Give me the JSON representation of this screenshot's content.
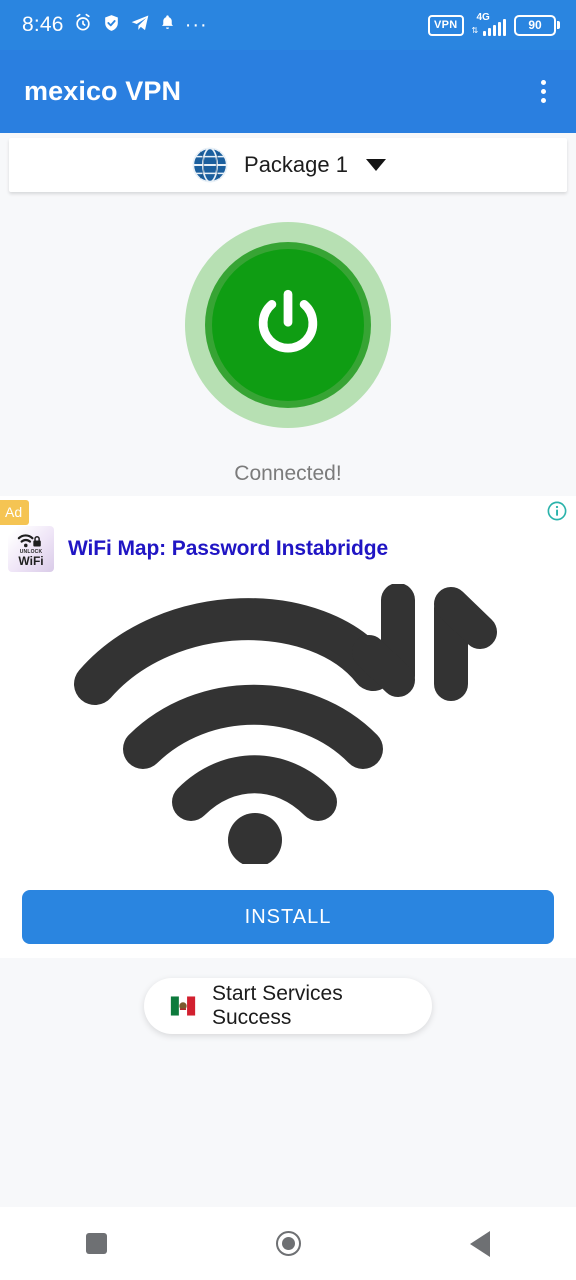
{
  "status_bar": {
    "time": "8:46",
    "left_icons": [
      "alarm-clock-icon",
      "shield-check-icon",
      "telegram-icon",
      "bell-icon",
      "more-dots-icon"
    ],
    "ellipsis": "···",
    "vpn_label": "VPN",
    "network_type": "4G",
    "battery_level": "90",
    "bg_color": "#2a85e0"
  },
  "app_bar": {
    "title": "mexico VPN",
    "overflow_name": "overflow-menu",
    "bg_color": "#2a7fe0"
  },
  "package_selector": {
    "icon": "globe-icon",
    "label": "Package 1",
    "caret": "chevron-down-icon"
  },
  "connection": {
    "button_name": "power-toggle-button",
    "state_label": "Connected!",
    "on_color": "#0f9d13",
    "halo_color": "#b7e0b3",
    "ring_color": "#37a434"
  },
  "ad": {
    "badge_label": "Ad",
    "info_icon": "info-icon",
    "app_icon_top_text": "UNLOCK",
    "app_icon_bottom_text": "WiFi",
    "title": "WiFi Map: Password Instabridge",
    "title_color": "#2015c4",
    "media_icon": "wifi-transfer-icon",
    "cta_label": "INSTALL",
    "cta_color": "#2a85e0"
  },
  "toast": {
    "icon": "mexico-flag-icon",
    "message": "Start Services Success"
  },
  "nav_bar": {
    "recents_label": "recents-button",
    "home_label": "home-button",
    "back_label": "back-button"
  }
}
